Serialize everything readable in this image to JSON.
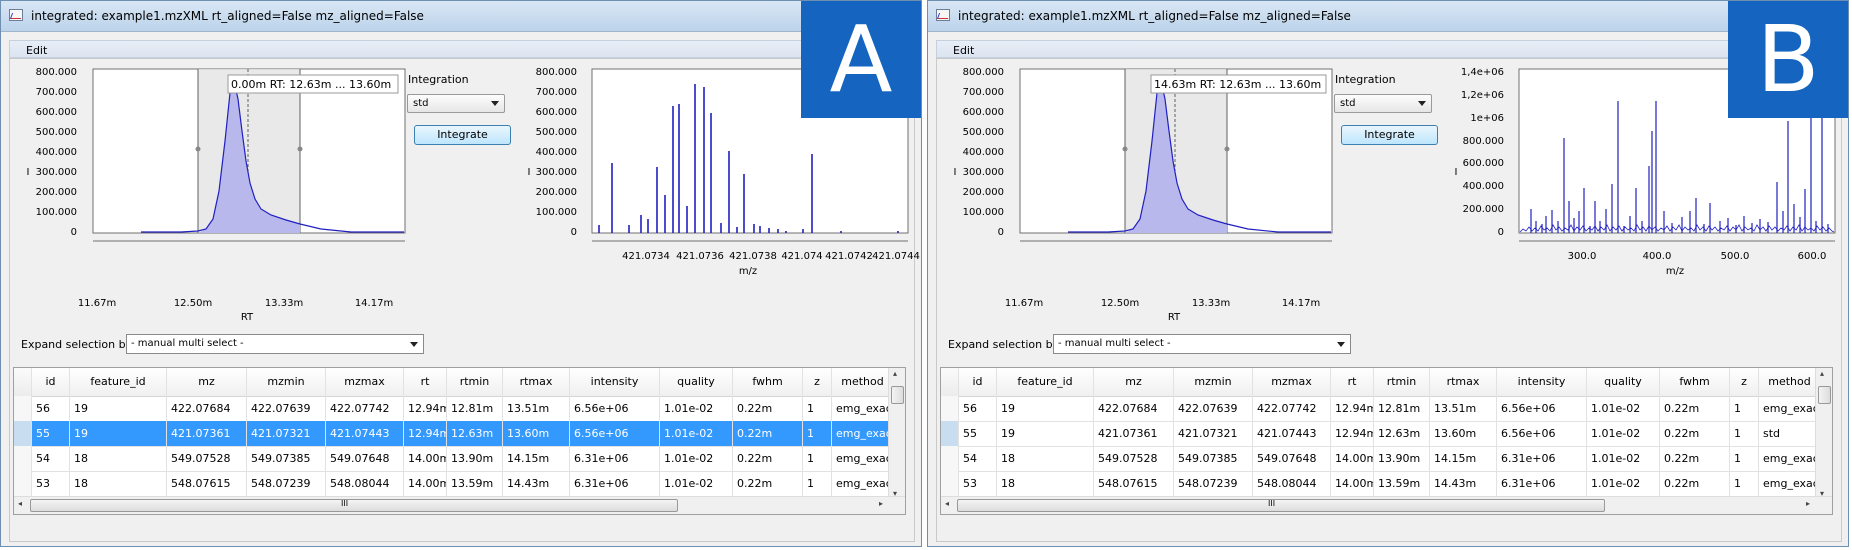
{
  "windows": [
    {
      "badge": "A",
      "title": "integrated: example1.mzXML rt_aligned=False mz_aligned=False",
      "menu": [
        "Edit"
      ],
      "rt_plot": {
        "y_ticks": [
          "800.000",
          "700.000",
          "600.000",
          "500.000",
          "400.000",
          "300.000",
          "200.000",
          "100.000",
          "0"
        ],
        "y_label": "I",
        "x_ticks": [
          "11.67m",
          "12.50m",
          "13.33m",
          "14.17m"
        ],
        "x_label": "RT",
        "tooltip": "0.00m RT: 12.63m ... 13.60m"
      },
      "spectrum_plot": {
        "y_ticks": [
          "800.000",
          "700.000",
          "600.000",
          "500.000",
          "400.000",
          "300.000",
          "200.000",
          "100.000",
          "0"
        ],
        "y_label": "I",
        "x_ticks": [
          "421.0734",
          "421.0736",
          "421.0738",
          "421.074",
          "421.0742",
          "421.0744"
        ],
        "x_label": "m/z"
      },
      "integration_label": "Integration",
      "integration_value": "std",
      "integrate_button": "Integrate",
      "expand_label": "Expand selection by:",
      "expand_value": "- manual multi select -",
      "columns": [
        "id",
        "feature_id",
        "mz",
        "mzmin",
        "mzmax",
        "rt",
        "rtmin",
        "rtmax",
        "intensity",
        "quality",
        "fwhm",
        "z",
        "method"
      ],
      "rows": [
        [
          "56",
          "19",
          "422.07684",
          "422.07639",
          "422.07742",
          "12.94m",
          "12.81m",
          "13.51m",
          "6.56e+06",
          "1.01e-02",
          "0.22m",
          "1",
          "emg_exact"
        ],
        [
          "55",
          "19",
          "421.07361",
          "421.07321",
          "421.07443",
          "12.94m",
          "12.63m",
          "13.60m",
          "6.56e+06",
          "1.01e-02",
          "0.22m",
          "1",
          "emg_exact"
        ],
        [
          "54",
          "18",
          "549.07528",
          "549.07385",
          "549.07648",
          "14.00m",
          "13.90m",
          "14.15m",
          "6.31e+06",
          "1.01e-02",
          "0.22m",
          "1",
          "emg_exact"
        ],
        [
          "53",
          "18",
          "548.07615",
          "548.07239",
          "548.08044",
          "14.00m",
          "13.59m",
          "14.43m",
          "6.31e+06",
          "1.01e-02",
          "0.22m",
          "1",
          "emg_exact"
        ]
      ],
      "selected_row": 1,
      "hscroll_label": "III"
    },
    {
      "badge": "B",
      "title": "integrated: example1.mzXML rt_aligned=False mz_aligned=False",
      "menu": [
        "Edit"
      ],
      "rt_plot": {
        "y_ticks": [
          "800.000",
          "700.000",
          "600.000",
          "500.000",
          "400.000",
          "300.000",
          "200.000",
          "100.000",
          "0"
        ],
        "y_label": "I",
        "x_ticks": [
          "11.67m",
          "12.50m",
          "13.33m",
          "14.17m"
        ],
        "x_label": "RT",
        "tooltip": "14.63m RT: 12.63m ... 13.60m"
      },
      "spectrum_plot": {
        "y_ticks": [
          "1,4e+06",
          "1,2e+06",
          "1e+06",
          "800.000",
          "600.000",
          "400.000",
          "200.000",
          "0"
        ],
        "y_label": "I",
        "x_ticks": [
          "300.0",
          "400.0",
          "500.0",
          "600.0"
        ],
        "x_label": "m/z"
      },
      "integration_label": "Integration",
      "integration_value": "std",
      "integrate_button": "Integrate",
      "expand_label": "Expand selection by:",
      "expand_value": "- manual multi select -",
      "columns": [
        "id",
        "feature_id",
        "mz",
        "mzmin",
        "mzmax",
        "rt",
        "rtmin",
        "rtmax",
        "intensity",
        "quality",
        "fwhm",
        "z",
        "method"
      ],
      "rows": [
        [
          "56",
          "19",
          "422.07684",
          "422.07639",
          "422.07742",
          "12.94m",
          "12.81m",
          "13.51m",
          "6.56e+06",
          "1.01e-02",
          "0.22m",
          "1",
          "emg_exact"
        ],
        [
          "55",
          "19",
          "421.07361",
          "421.07321",
          "421.07443",
          "12.94m",
          "12.63m",
          "13.60m",
          "6.56e+06",
          "1.01e-02",
          "0.22m",
          "1",
          "std"
        ],
        [
          "54",
          "18",
          "549.07528",
          "549.07385",
          "549.07648",
          "14.00m",
          "13.90m",
          "14.15m",
          "6.31e+06",
          "1.01e-02",
          "0.22m",
          "1",
          "emg_exact"
        ],
        [
          "53",
          "18",
          "548.07615",
          "548.07239",
          "548.08044",
          "14.00m",
          "13.59m",
          "14.43m",
          "6.31e+06",
          "1.01e-02",
          "0.22m",
          "1",
          "emg_exact"
        ]
      ],
      "selected_row": -1,
      "hscroll_label": "III"
    }
  ],
  "colors": {
    "accent": "#1565c0",
    "selection": "#3399ff",
    "plot_line": "#2020c0",
    "plot_fill": "#b8b8ec"
  }
}
